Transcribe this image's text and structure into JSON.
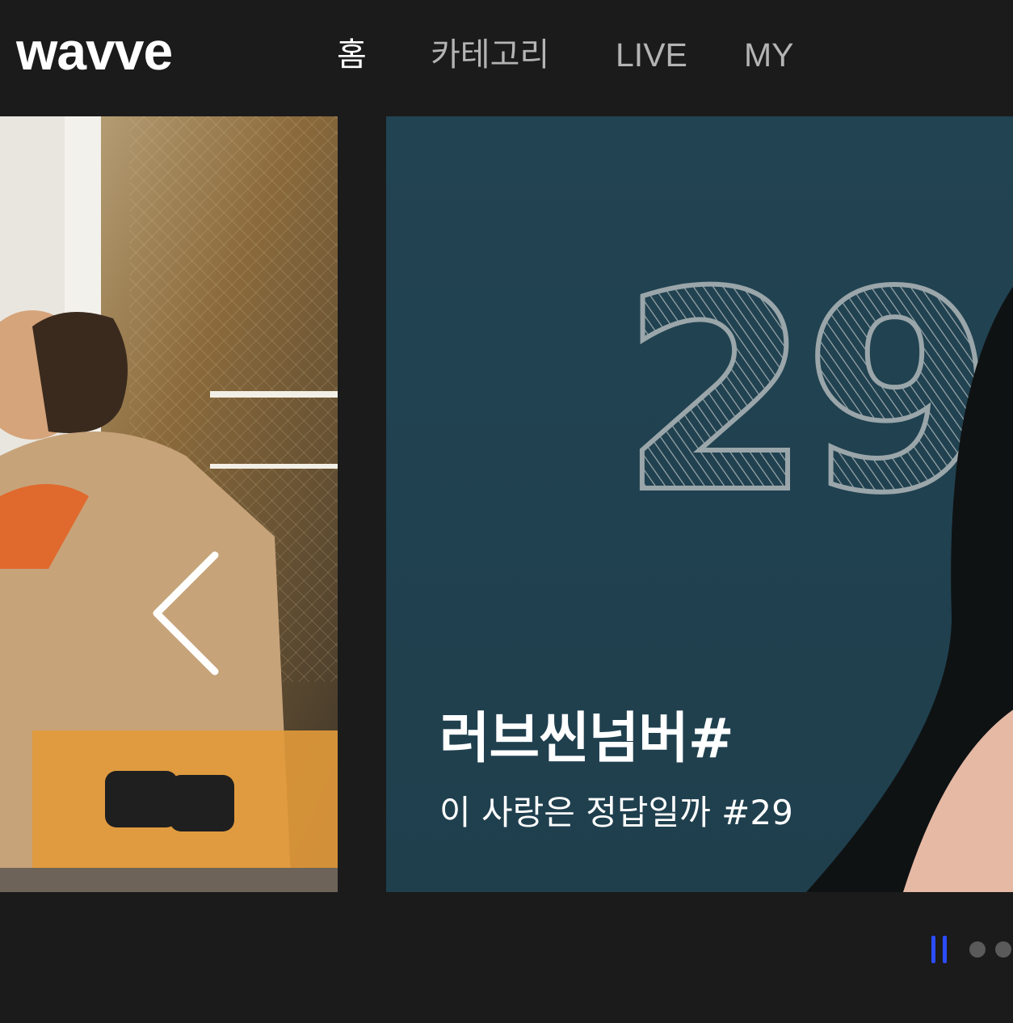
{
  "header": {
    "logo_text": "wavve",
    "nav": [
      {
        "label": "홈",
        "active": true
      },
      {
        "label": "카테고리",
        "active": false
      },
      {
        "label": "LIVE",
        "active": false
      },
      {
        "label": "MY",
        "active": false
      }
    ]
  },
  "carousel": {
    "current_slide": {
      "title": "러브씬넘버#",
      "subtitle": "이 사랑은 정답일까 #29",
      "artwork_text": "29"
    },
    "prev_arrow_icon": "chevron-left-icon",
    "pause_icon": "pause-icon"
  },
  "colors": {
    "background": "#1b1b1b",
    "nav_active": "#ffffff",
    "nav_inactive": "#b4b4b4",
    "indicator_accent": "#2b4cff",
    "slide_bg": "#1f4352"
  }
}
